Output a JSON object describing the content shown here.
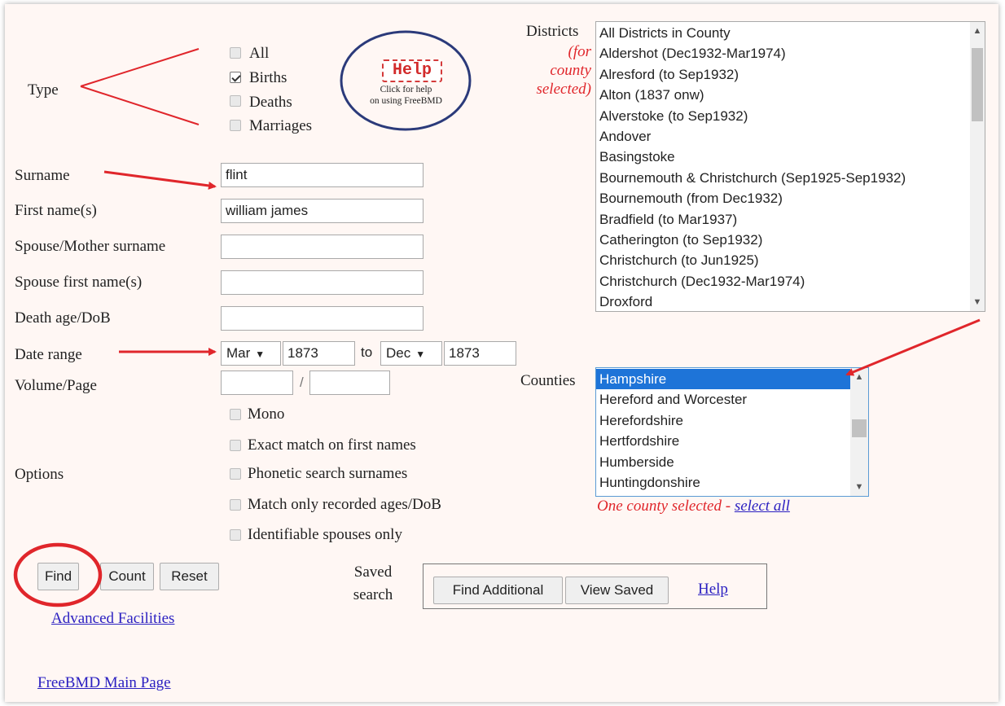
{
  "type_section": {
    "label": "Type",
    "options": [
      {
        "label": "All",
        "checked": false
      },
      {
        "label": "Births",
        "checked": true
      },
      {
        "label": "Deaths",
        "checked": false
      },
      {
        "label": "Marriages",
        "checked": false
      }
    ]
  },
  "help_badge": {
    "stamp": "Help",
    "line1": "Click for help",
    "line2": "on using FreeBMD"
  },
  "districts": {
    "label": "Districts",
    "note": [
      "(for",
      "county",
      "selected)"
    ],
    "items": [
      "All Districts in County",
      "Aldershot (Dec1932-Mar1974)",
      "Alresford (to Sep1932)",
      "Alton (1837 onw)",
      "Alverstoke (to Sep1932)",
      "Andover",
      "Basingstoke",
      "Bournemouth & Christchurch (Sep1925-Sep1932)",
      "Bournemouth (from Dec1932)",
      "Bradfield (to Mar1937)",
      "Catherington (to Sep1932)",
      "Christchurch (to Jun1925)",
      "Christchurch (Dec1932-Mar1974)",
      "Droxford"
    ]
  },
  "fields": {
    "surname": {
      "label": "Surname",
      "value": "flint"
    },
    "first_names": {
      "label": "First name(s)",
      "value": "william james"
    },
    "spouse_surname": {
      "label": "Spouse/Mother surname",
      "value": ""
    },
    "spouse_first": {
      "label": "Spouse first name(s)",
      "value": ""
    },
    "death_age": {
      "label": "Death age/DoB",
      "value": ""
    }
  },
  "date_range": {
    "label": "Date range",
    "from_quarter": "Mar",
    "from_year": "1873",
    "to_label": "to",
    "to_quarter": "Dec",
    "to_year": "1873"
  },
  "volume_page": {
    "label": "Volume/Page",
    "separator": "/",
    "volume": "",
    "page": ""
  },
  "counties": {
    "label": "Counties",
    "items": [
      "Hampshire",
      "Hereford and Worcester",
      "Herefordshire",
      "Hertfordshire",
      "Humberside",
      "Huntingdonshire"
    ],
    "selected": "Hampshire",
    "status_text": "One county selected - ",
    "select_all": "select all"
  },
  "options": {
    "label": "Options",
    "items": [
      {
        "label": "Mono",
        "checked": false
      },
      {
        "label": "Exact match on first names",
        "checked": false
      },
      {
        "label": "Phonetic search surnames",
        "checked": false
      },
      {
        "label": "Match only recorded ages/DoB",
        "checked": false
      },
      {
        "label": "Identifiable spouses only",
        "checked": false
      }
    ]
  },
  "buttons": {
    "find": "Find",
    "count": "Count",
    "reset": "Reset"
  },
  "saved_search": {
    "label_line1": "Saved",
    "label_line2": "search",
    "find_additional": "Find Additional",
    "view_saved": "View Saved",
    "help": "Help"
  },
  "links": {
    "advanced": "Advanced Facilities",
    "main_page": "FreeBMD Main Page"
  },
  "colors": {
    "annotation_red": "#e0262b",
    "help_circle": "#2b3a7a",
    "link": "#2a1fc1",
    "selection": "#1e74d8"
  }
}
